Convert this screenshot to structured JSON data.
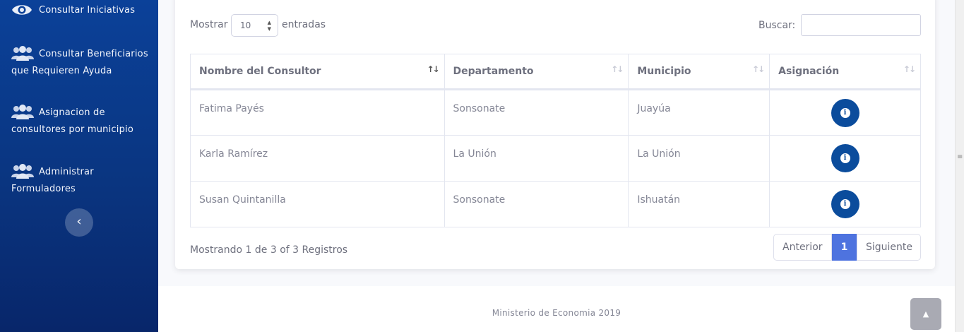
{
  "sidebar": {
    "items": [
      {
        "label_line1": "Consultar Iniciativas",
        "label_line2": "",
        "icon": "eye-icon"
      },
      {
        "label_line1": "Consultar Beneficiarios",
        "label_line2": "que Requieren Ayuda",
        "icon": "users-icon"
      },
      {
        "label_line1": "Asignacion de",
        "label_line2": "consultores por municipio",
        "icon": "users-icon"
      },
      {
        "label_line1": "Administrar",
        "label_line2": "Formuladores",
        "icon": "users-icon"
      }
    ],
    "collapse_icon": "‹"
  },
  "table_controls": {
    "show_label": "Mostrar",
    "entries_value": "10",
    "entries_label": "entradas",
    "search_label": "Buscar:",
    "search_value": ""
  },
  "table": {
    "columns": [
      "Nombre del Consultor",
      "Departamento",
      "Municipio",
      "Asignación"
    ],
    "rows": [
      {
        "name": "Fatima Payés",
        "department": "Sonsonate",
        "municipality": "Juayúa"
      },
      {
        "name": "Karla Ramírez",
        "department": "La Unión",
        "municipality": "La Unión"
      },
      {
        "name": "Susan Quintanilla",
        "department": "Sonsonate",
        "municipality": "Ishuatán"
      }
    ],
    "action_icon": "i"
  },
  "pagination": {
    "info": "Mostrando 1 de 3 of 3 Registros",
    "prev": "Anterior",
    "current": "1",
    "next": "Siguiente"
  },
  "footer": {
    "text": "Ministerio de Economia 2019",
    "scroll_top_icon": "▲"
  },
  "colors": {
    "sidebar": "#0b4199",
    "action_button": "#0b4c9c",
    "active_page": "#4e73df"
  }
}
